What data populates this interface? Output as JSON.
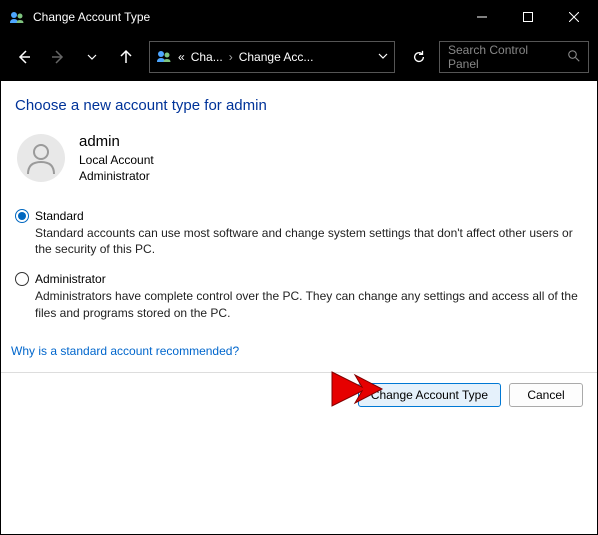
{
  "titlebar": {
    "title": "Change Account Type"
  },
  "addrbar": {
    "crumb_prefix": "«",
    "crumb1": "Cha...",
    "crumb2": "Change Acc...",
    "search_placeholder": "Search Control Panel"
  },
  "content": {
    "page_title": "Choose a new account type for admin",
    "user": {
      "name": "admin",
      "type": "Local Account",
      "role": "Administrator"
    },
    "options": {
      "standard": {
        "label": "Standard",
        "desc": "Standard accounts can use most software and change system settings that don't affect other users or the security of this PC."
      },
      "admin": {
        "label": "Administrator",
        "desc": "Administrators have complete control over the PC. They can change any settings and access all of the files and programs stored on the PC."
      }
    },
    "help_link": "Why is a standard account recommended?",
    "buttons": {
      "change": "Change Account Type",
      "cancel": "Cancel"
    }
  }
}
